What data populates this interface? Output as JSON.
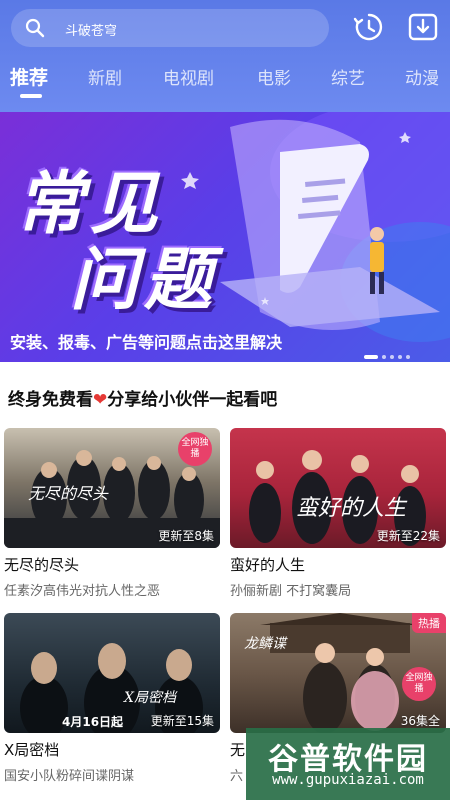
{
  "search": {
    "placeholder_text": "斗破苍穹"
  },
  "header": {
    "history_icon": "history-icon",
    "download_icon": "download-icon"
  },
  "tabs": [
    {
      "label": "推荐",
      "active": true
    },
    {
      "label": "新剧"
    },
    {
      "label": "电视剧"
    },
    {
      "label": "电影"
    },
    {
      "label": "综艺"
    },
    {
      "label": "动漫"
    }
  ],
  "banner": {
    "title_line1": "常见",
    "title_line2": "问题",
    "caption": "安装、报毒、广告等问题点击这里解决"
  },
  "promo": {
    "text_before": "终身免费看",
    "text_after": "分享给小伙伴一起看吧"
  },
  "cards": [
    {
      "title": "无尽的尽头",
      "subtitle": "任素汐高伟光对抗人性之恶",
      "episodes": "更新至8集",
      "badge": "全网独播",
      "poster_text": "无尽的尽头"
    },
    {
      "title": "蛮好的人生",
      "subtitle": "孙俪新剧 不打窝囊局",
      "episodes": "更新至22集",
      "poster_text": "蛮好的人生"
    },
    {
      "title": "X局密档",
      "subtitle": "国安小队粉碎间谍阴谋",
      "episodes": "更新至15集",
      "poster_text": "X局密档",
      "poster_date": "4月16日起"
    },
    {
      "title": "无",
      "subtitle": "六",
      "episodes": "36集全",
      "hot": "热播",
      "badge": "全网独播",
      "poster_text": "龙鳞谍"
    }
  ],
  "watermark": {
    "name": "谷普软件园",
    "url": "www.gupuxiazai.com"
  },
  "colors": {
    "header": "#5a79e6",
    "accent": "#e8416a",
    "banner": "#5a3ee8"
  }
}
